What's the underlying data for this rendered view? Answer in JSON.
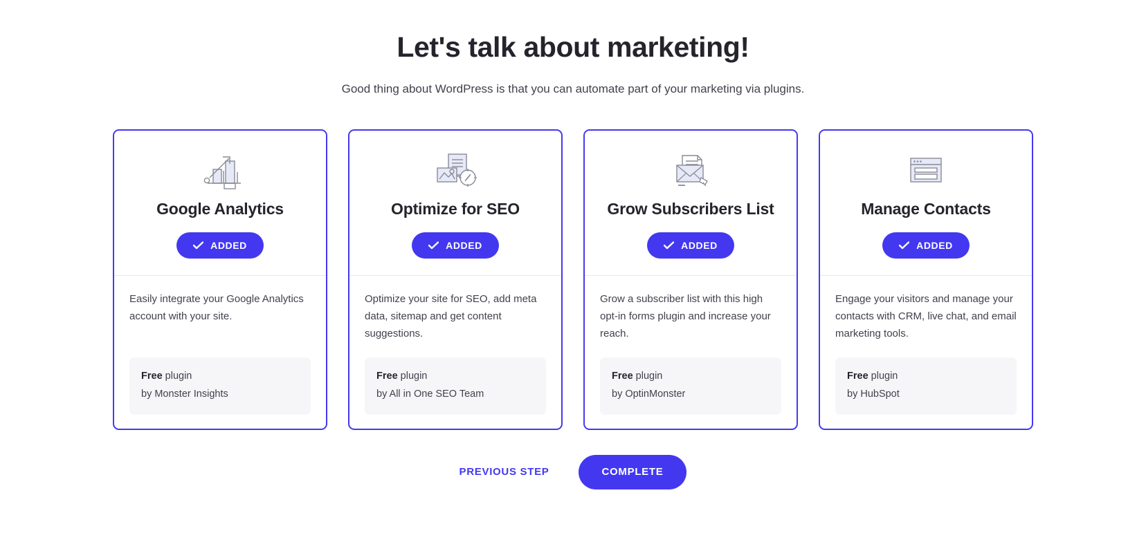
{
  "header": {
    "title": "Let's talk about marketing!",
    "subtitle": "Good thing about WordPress is that you can automate part of your marketing via plugins."
  },
  "theme": {
    "accent": "#4338f0",
    "text_dark": "#24242c",
    "text_body": "#41414d",
    "footer_bg": "#f6f6f9",
    "divider": "#e8e8ee"
  },
  "cards": [
    {
      "icon": "bar-chart-growth-icon",
      "title": "Google Analytics",
      "button_label": "ADDED",
      "description": "Easily integrate your Google Analytics account with your site.",
      "price_label": "Free",
      "price_suffix": " plugin",
      "author": "by Monster Insights"
    },
    {
      "icon": "seo-document-compass-icon",
      "title": "Optimize for SEO",
      "button_label": "ADDED",
      "description": "Optimize your site for SEO, add meta data, sitemap and get content suggestions.",
      "price_label": "Free",
      "price_suffix": " plugin",
      "author": "by All in One SEO Team"
    },
    {
      "icon": "envelope-letter-icon",
      "title": "Grow Subscribers List",
      "button_label": "ADDED",
      "description": "Grow a subscriber list with this high opt-in forms plugin and increase your reach.",
      "price_label": "Free",
      "price_suffix": " plugin",
      "author": "by OptinMonster"
    },
    {
      "icon": "browser-window-form-icon",
      "title": "Manage Contacts",
      "button_label": "ADDED",
      "description": "Engage your visitors and manage your contacts with CRM, live chat, and email marketing tools.",
      "price_label": "Free",
      "price_suffix": " plugin",
      "author": "by HubSpot"
    }
  ],
  "actions": {
    "previous_label": "PREVIOUS STEP",
    "complete_label": "COMPLETE"
  }
}
